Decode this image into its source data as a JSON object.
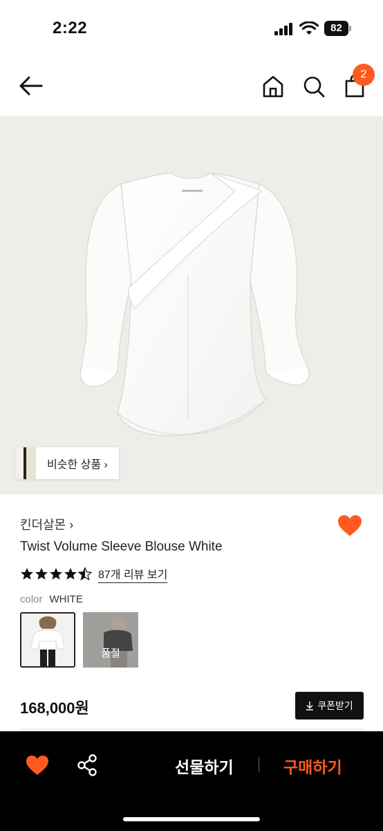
{
  "status_bar": {
    "time": "2:22",
    "battery": "82"
  },
  "nav": {
    "cart_count": "2"
  },
  "hero": {
    "similar_label": "비슷한 상품 ›"
  },
  "product": {
    "brand": "킨더살몬 ›",
    "title": "Twist Volume Sleeve Blouse White",
    "rating": 4.5,
    "reviews": "87개 리뷰 보기",
    "color_label": "color",
    "color_value": "WHITE",
    "sold_out": "품절",
    "price": "168,000원",
    "coupon": "쿠폰받기"
  },
  "bottom": {
    "gift": "선물하기",
    "buy": "구매하기"
  },
  "colors": {
    "accent": "#ff5a1f",
    "dark": "#000000"
  },
  "icons": [
    "back-arrow-icon",
    "home-icon",
    "search-icon",
    "bag-icon",
    "heart-icon",
    "star-icon",
    "download-icon",
    "share-icon"
  ]
}
